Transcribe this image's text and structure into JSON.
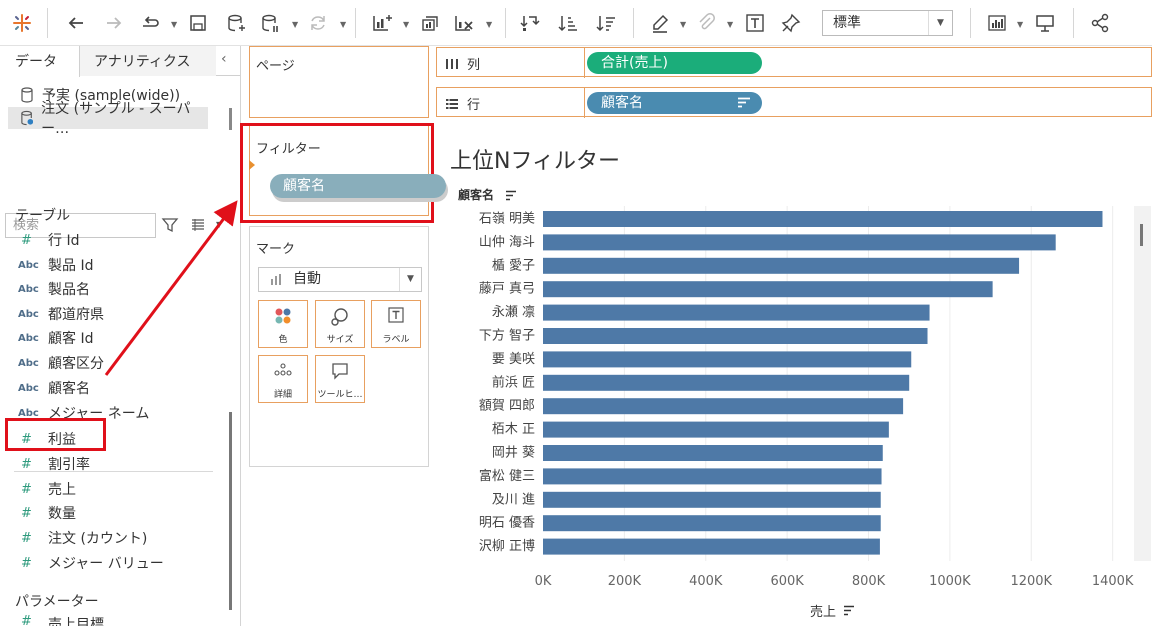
{
  "toolbar": {
    "fit_value": "標準"
  },
  "data_pane": {
    "tabs": [
      "データ",
      "アナリティクス"
    ],
    "datasources": [
      "予実 (sample(wide))",
      "注文 (サンプル - スーパー…"
    ],
    "search_placeholder": "検索",
    "tables_header": "テーブル",
    "dimensions": [
      {
        "icon": "#",
        "name": "行 Id"
      },
      {
        "icon": "Abc",
        "name": "製品 Id"
      },
      {
        "icon": "Abc",
        "name": "製品名"
      },
      {
        "icon": "Abc",
        "name": "都道府県"
      },
      {
        "icon": "Abc",
        "name": "顧客 Id"
      },
      {
        "icon": "Abc",
        "name": "顧客区分"
      },
      {
        "icon": "Abc",
        "name": "顧客名"
      },
      {
        "icon": "Abc",
        "name": "メジャー ネーム"
      }
    ],
    "measures": [
      {
        "icon": "#",
        "name": "利益"
      },
      {
        "icon": "#",
        "name": "割引率"
      },
      {
        "icon": "#",
        "name": "売上"
      },
      {
        "icon": "#",
        "name": "数量"
      },
      {
        "icon": "#",
        "name": "注文 (カウント)"
      },
      {
        "icon": "#",
        "name": "メジャー バリュー"
      }
    ],
    "parameters_header": "パラメーター",
    "parameter_partial": "売上目標"
  },
  "cards": {
    "pages_title": "ページ",
    "filters_title": "フィルター",
    "filter_pill": "顧客名",
    "marks_title": "マーク",
    "mark_type": "自動",
    "mark_buttons": [
      "色",
      "サイズ",
      "ラベル",
      "詳細",
      "ツールヒ…"
    ]
  },
  "shelves": {
    "columns_label": "列",
    "columns_pill": "合計(売上)",
    "rows_label": "行",
    "rows_pill": "顧客名"
  },
  "viz": {
    "title": "上位Nフィルター"
  },
  "chart_data": {
    "type": "bar",
    "orientation": "horizontal",
    "title": "上位Nフィルター",
    "ylabel": "顧客名",
    "xlabel": "売上",
    "categories": [
      "石嶺 明美",
      "山仲 海斗",
      "楯 愛子",
      "藤戸 真弓",
      "永瀬 凛",
      "下方 智子",
      "要 美咲",
      "前浜 匠",
      "額賀 四郎",
      "栢木 正",
      "岡井 葵",
      "富松 健三",
      "及川 進",
      "明石 優香",
      "沢柳 正博"
    ],
    "values": [
      1375000,
      1260000,
      1170000,
      1105000,
      950000,
      945000,
      905000,
      900000,
      885000,
      850000,
      835000,
      832000,
      830000,
      830000,
      828000
    ],
    "xlim": [
      0,
      1450000
    ],
    "xticks": [
      0,
      200000,
      400000,
      600000,
      800000,
      1000000,
      1200000,
      1400000
    ],
    "xtick_labels": [
      "0K",
      "200K",
      "400K",
      "600K",
      "800K",
      "1000K",
      "1200K",
      "1400K"
    ],
    "bar_color": "#4e79a7",
    "grid": "vertical"
  },
  "colors": {
    "highlight_red": "#e0101a",
    "card_border": "#e8a060",
    "measure_pill": "#1bad7a",
    "dimension_pill": "#4a8bb0",
    "filter_pill": "#89aebb"
  }
}
